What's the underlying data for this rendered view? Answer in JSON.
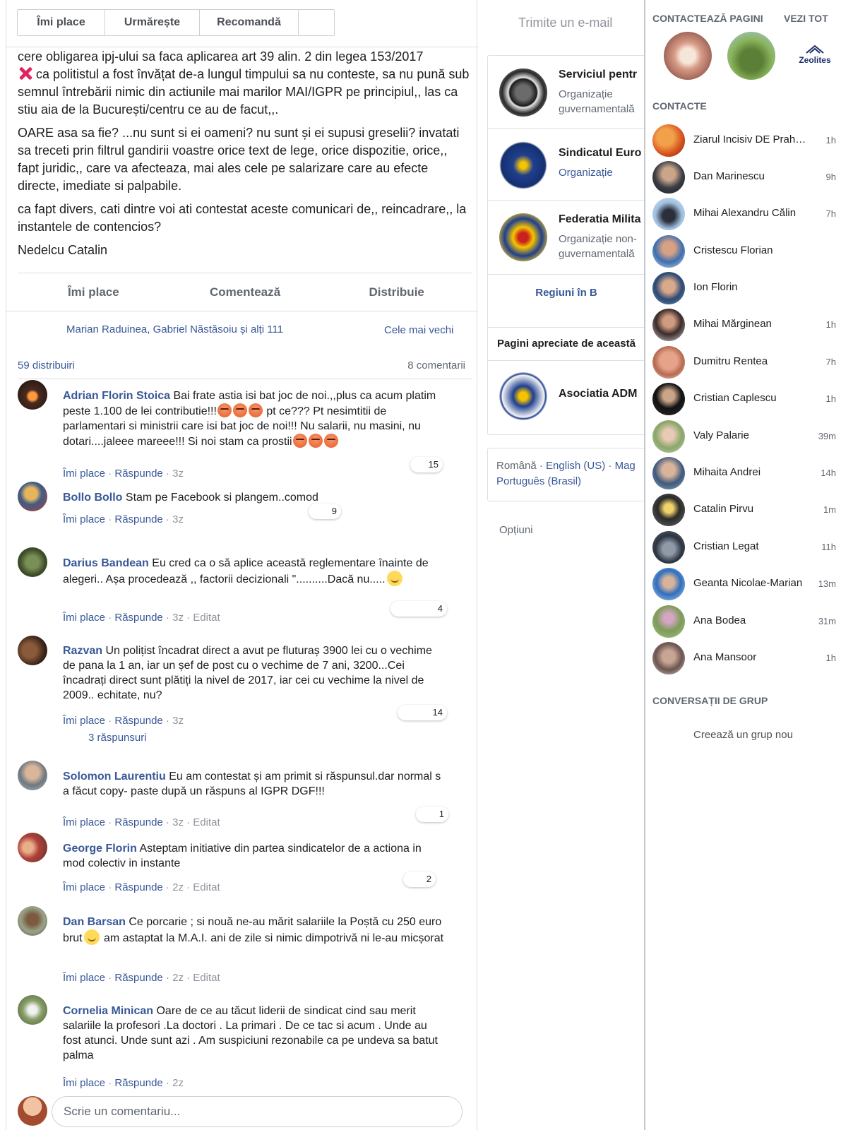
{
  "top_actions": {
    "like": "Îmi place",
    "follow": "Urmărește",
    "recommend": "Recomandă",
    "send_email": "Trimite un e-mail"
  },
  "post": {
    "paragraphs": [
      "cere obligarea ipj-ului sa faca aplicarea art 39 alin. 2 din legea 153/2017",
      "ca politistul a fost învățat de-a lungul timpului sa nu conteste, sa nu pună sub semnul întrebării nimic din actiunile mai marilor MAI/IGPR pe principiul,, las ca stiu aia de la București/centru ce au de facut,,.",
      "OARE asa sa fie? ...nu sunt si ei oameni? nu sunt și ei supusi greselii? invatati sa treceti prin filtrul gandirii voastre orice text de lege, orice dispozitie, orice,, fapt juridic,, care va afecteaza, mai ales cele pe salarizare care au efecte directe, imediate si palpabile.",
      "ca fapt divers, cati dintre voi ati contestat aceste comunicari de,, reincadrare,, la instantele de contencios?",
      "Nedelcu Catalin"
    ],
    "actions": {
      "like": "Îmi place",
      "comment": "Comentează",
      "share": "Distribuie"
    },
    "likers": "Marian Raduinea, Gabriel Năstăsoiu și alți 111",
    "sort": "Cele mai vechi",
    "shares": "59 distribuiri",
    "comments_count": "8 comentarii"
  },
  "comments": [
    {
      "name": "Adrian Florin Stoica",
      "text_a": "Bai frate astia isi bat joc de noi.,,plus ca acum platim peste 1.100 de lei contributie!!!",
      "text_b": " pt ce??? Pt nesimtitii de parlamentari si ministrii care isi bat joc de noi!!! Nu salarii, nu masini, nu dotari....jaleee mareee!!! Si noi stam ca prostii",
      "like": "Îmi place",
      "reply": "Răspunde",
      "time": "3z",
      "reactions": "15"
    },
    {
      "name": "Bollo Bollo",
      "text": "Stam pe Facebook si plangem..comod",
      "like": "Îmi place",
      "reply": "Răspunde",
      "time": "3z",
      "reactions": "9"
    },
    {
      "name": "Darius Bandean",
      "text": "Eu cred ca o să aplice această reglementare înainte de alegeri.. Așa procedează ,, factorii decizionali \"..........Dacă nu.....",
      "like": "Îmi place",
      "reply": "Răspunde",
      "time": "3z",
      "edited": "Editat",
      "reactions": "4"
    },
    {
      "name": "Razvan",
      "text": "Un polițist încadrat direct a avut pe fluturaș 3900 lei cu o vechime de pana la 1 an, iar un șef de post cu o vechime de 7 ani, 3200...Cei încadrați direct sunt plătiți la nivel de 2017, iar cei cu vechime la nivel de 2009.. echitate, nu?",
      "like": "Îmi place",
      "reply": "Răspunde",
      "time": "3z",
      "reactions": "14",
      "replies": "3 răspunsuri"
    },
    {
      "name": "Solomon Laurentiu",
      "text": "Eu am contestat și am primit si răspunsul.dar normal s a făcut copy- paste după un răspuns al IGPR DGF!!!",
      "like": "Îmi place",
      "reply": "Răspunde",
      "time": "3z",
      "edited": "Editat",
      "reactions": "1"
    },
    {
      "name": "George Florin",
      "text": "Asteptam initiative din partea sindicatelor de a actiona in mod colectiv in instante",
      "like": "Îmi place",
      "reply": "Răspunde",
      "time": "2z",
      "edited": "Editat",
      "reactions": "2"
    },
    {
      "name": "Dan Barsan",
      "text_a": "Ce porcarie ; si nouă ne-au mărit salariile la Poștă cu 250 euro brut",
      "text_b": " am astaptat la M.A.I. ani de zile si nimic dimpotrivă ni le-au micșorat",
      "like": "Îmi place",
      "reply": "Răspunde",
      "time": "2z",
      "edited": "Editat"
    },
    {
      "name": "Cornelia Minican",
      "text": "Oare de ce au tăcut liderii de sindicat cind sau merit salariile la profesori .La doctori . La primari . De ce tac si acum . Unde au fost atunci. Unde sunt azi . Am suspiciuni rezonabile ca pe undeva sa batut palma",
      "like": "Îmi place",
      "reply": "Răspunde",
      "time": "2z"
    }
  ],
  "write_comment": {
    "placeholder": "Scrie un comentariu..."
  },
  "middle": {
    "pages": [
      {
        "name": "Serviciul pentr",
        "category": "Organizație guvernamentală"
      },
      {
        "name": "Sindicatul Euro",
        "category": "Organizație"
      },
      {
        "name": "Federatia Milita",
        "category": "Organizație non-guvernamentală"
      }
    ],
    "regions": "Regiuni în B",
    "liked_title": "Pagini apreciate de această",
    "liked_page": "Asociatia ADM",
    "lang_current": "Română",
    "lang_sep1": " · ",
    "lang_en": "English (US)",
    "lang_sep2": " · ",
    "lang_mag": "Mag",
    "lang_pt": "Português (Brasil)",
    "options": "Opțiuni"
  },
  "sidebar": {
    "contact_pages_title": "CONTACTEAZĂ PAGINI",
    "see_all": "VEZI TOT",
    "zeolites_logo": "Zeolites",
    "contacts_title": "CONTACTE",
    "contacts": [
      {
        "name": "Ziarul Incisiv DE Prahova",
        "time": "1h"
      },
      {
        "name": "Dan Marinescu",
        "time": "9h"
      },
      {
        "name": "Mihai Alexandru Călin",
        "time": "7h"
      },
      {
        "name": "Cristescu Florian",
        "time": ""
      },
      {
        "name": "Ion Florin",
        "time": ""
      },
      {
        "name": "Mihai Mărginean",
        "time": "1h"
      },
      {
        "name": "Dumitru Rentea",
        "time": "7h"
      },
      {
        "name": "Cristian Caplescu",
        "time": "1h"
      },
      {
        "name": "Valy Palarie",
        "time": "39m"
      },
      {
        "name": "Mihaita Andrei",
        "time": "14h"
      },
      {
        "name": "Catalin Pirvu",
        "time": "1m"
      },
      {
        "name": "Cristian Legat",
        "time": "11h"
      },
      {
        "name": "Geanta Nicolae-Marian",
        "time": "13m"
      },
      {
        "name": "Ana Bodea",
        "time": "31m"
      },
      {
        "name": "Ana Mansoor",
        "time": "1h"
      }
    ],
    "group_title": "CONVERSAȚII DE GRUP",
    "new_group": "Creează un grup nou"
  },
  "colors": {
    "link": "#385898",
    "muted": "#606770",
    "border": "#dddfe2"
  }
}
